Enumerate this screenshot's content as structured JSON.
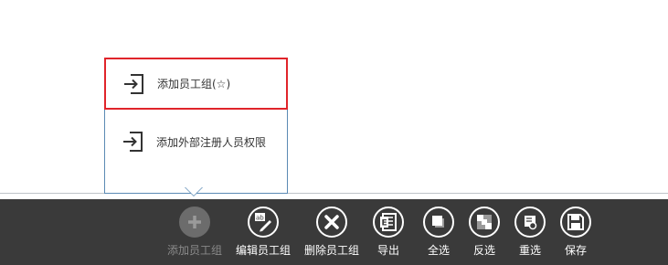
{
  "popup": {
    "items": [
      {
        "label": "添加员工组(☆)",
        "icon": "enter-icon"
      },
      {
        "label": "添加外部注册人员权限",
        "icon": "enter-icon"
      }
    ]
  },
  "toolbar": {
    "buttons": [
      {
        "label": "添加员工组",
        "icon": "plus-icon",
        "disabled": true
      },
      {
        "label": "编辑员工组",
        "icon": "edit-icon",
        "disabled": false
      },
      {
        "label": "删除员工组",
        "icon": "delete-icon",
        "disabled": false
      },
      {
        "label": "导出",
        "icon": "export-icon",
        "disabled": false
      },
      {
        "label": "全选",
        "icon": "select-all-icon",
        "disabled": false
      },
      {
        "label": "反选",
        "icon": "invert-selection-icon",
        "disabled": false
      },
      {
        "label": "重选",
        "icon": "reselect-icon",
        "disabled": false
      },
      {
        "label": "保存",
        "icon": "save-icon",
        "disabled": false
      }
    ]
  },
  "colors": {
    "toolbar_bg": "#3a3a3a",
    "highlight_border": "#e0242a",
    "popup_border": "#5b8ab4"
  }
}
